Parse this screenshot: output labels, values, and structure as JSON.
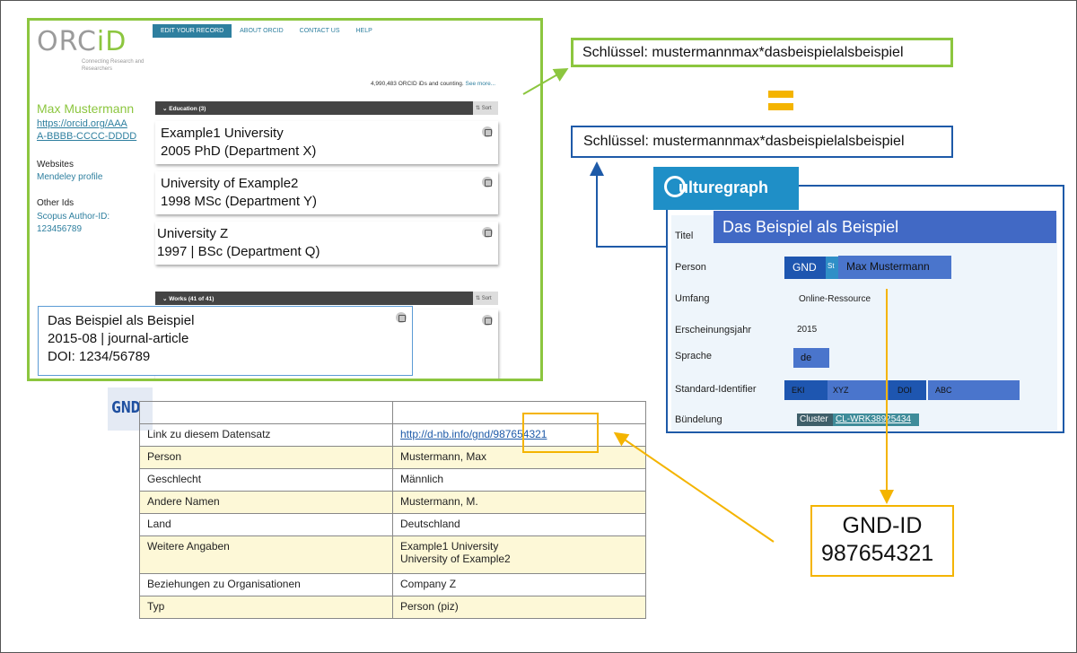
{
  "orcid": {
    "logo_main": "ORC",
    "logo_id": "iD",
    "tagline": "Connecting Research and Researchers",
    "nav": [
      "EDIT YOUR RECORD",
      "ABOUT ORCID",
      "CONTACT US",
      "HELP"
    ],
    "count_text": "4,990,483 ORCID iDs and counting.",
    "count_link": "See more...",
    "name": "Max Mustermann",
    "id_url_line1": "https://orcid.org/AAA",
    "id_url_line2": "A-BBBB-CCCC-DDDD",
    "websites_heading": "Websites",
    "website": "Mendeley profile",
    "other_ids_heading": "Other Ids",
    "scopus_label": "Scopus Author-ID:",
    "scopus_value": "123456789",
    "education_header": "Education (3)",
    "sort_label": "Sort",
    "education": [
      {
        "line1": "Example1 University",
        "line2": "2005 PhD (Department X)"
      },
      {
        "line1": "University of Example2",
        "line2": "1998 MSc (Department Y)"
      },
      {
        "line1": "University Z",
        "line2": "1997 | BSc (Department Q)"
      }
    ],
    "works_header": "Works (41 of 41)",
    "work": {
      "line1": "Das Beispiel als Beispiel",
      "line2": "2015-08 | journal-article",
      "line3": "DOI: 1234/56789"
    }
  },
  "key_orcid": "Schlüssel: mustermannmax*dasbeispielalsbeispiel",
  "key_culturegraph": "Schlüssel: mustermannmax*dasbeispielalsbeispiel",
  "culturegraph": {
    "logo": "ulturegraph",
    "titel_label": "Titel",
    "titel_value": "Das Beispiel als Beispiel",
    "person_label": "Person",
    "person_gnd": "GND",
    "person_st": "St",
    "person_value": "Max Mustermann",
    "umfang_label": "Umfang",
    "umfang_value": "Online-Ressource",
    "jahr_label": "Erscheinungsjahr",
    "jahr_value": "2015",
    "sprache_label": "Sprache",
    "sprache_value": "de",
    "std_label": "Standard-Identifier",
    "std_eki": "EKI",
    "std_xyz": "XYZ",
    "std_doi": "DOI",
    "std_abc": "ABC",
    "buendelung_label": "Bündelung",
    "cluster_label": "Cluster",
    "cluster_value": "CL-WRK38925434"
  },
  "gnd_id": {
    "label": "GND-ID",
    "value": "987654321"
  },
  "gnd": {
    "logo": "GND",
    "rows": [
      {
        "label": "",
        "value": ""
      },
      {
        "label": "Link zu diesem Datensatz",
        "value": "http://d-nb.info/gnd/987654321"
      },
      {
        "label": "Person",
        "value": "Mustermann, Max"
      },
      {
        "label": "Geschlecht",
        "value": "Männlich"
      },
      {
        "label": "Andere Namen",
        "value": "Mustermann, M."
      },
      {
        "label": "Land",
        "value": "Deutschland"
      },
      {
        "label": "Weitere Angaben",
        "value": "Example1 University",
        "value2": "University of Example2"
      },
      {
        "label": "Beziehungen zu Organisationen",
        "value": "Company Z"
      },
      {
        "label": "Typ",
        "value": "Person (piz)"
      }
    ]
  },
  "colors": {
    "orcid_green": "#8cc63f",
    "blue": "#1e5aa8",
    "yellow": "#f4b400",
    "cg_box": "#3e63b4"
  }
}
